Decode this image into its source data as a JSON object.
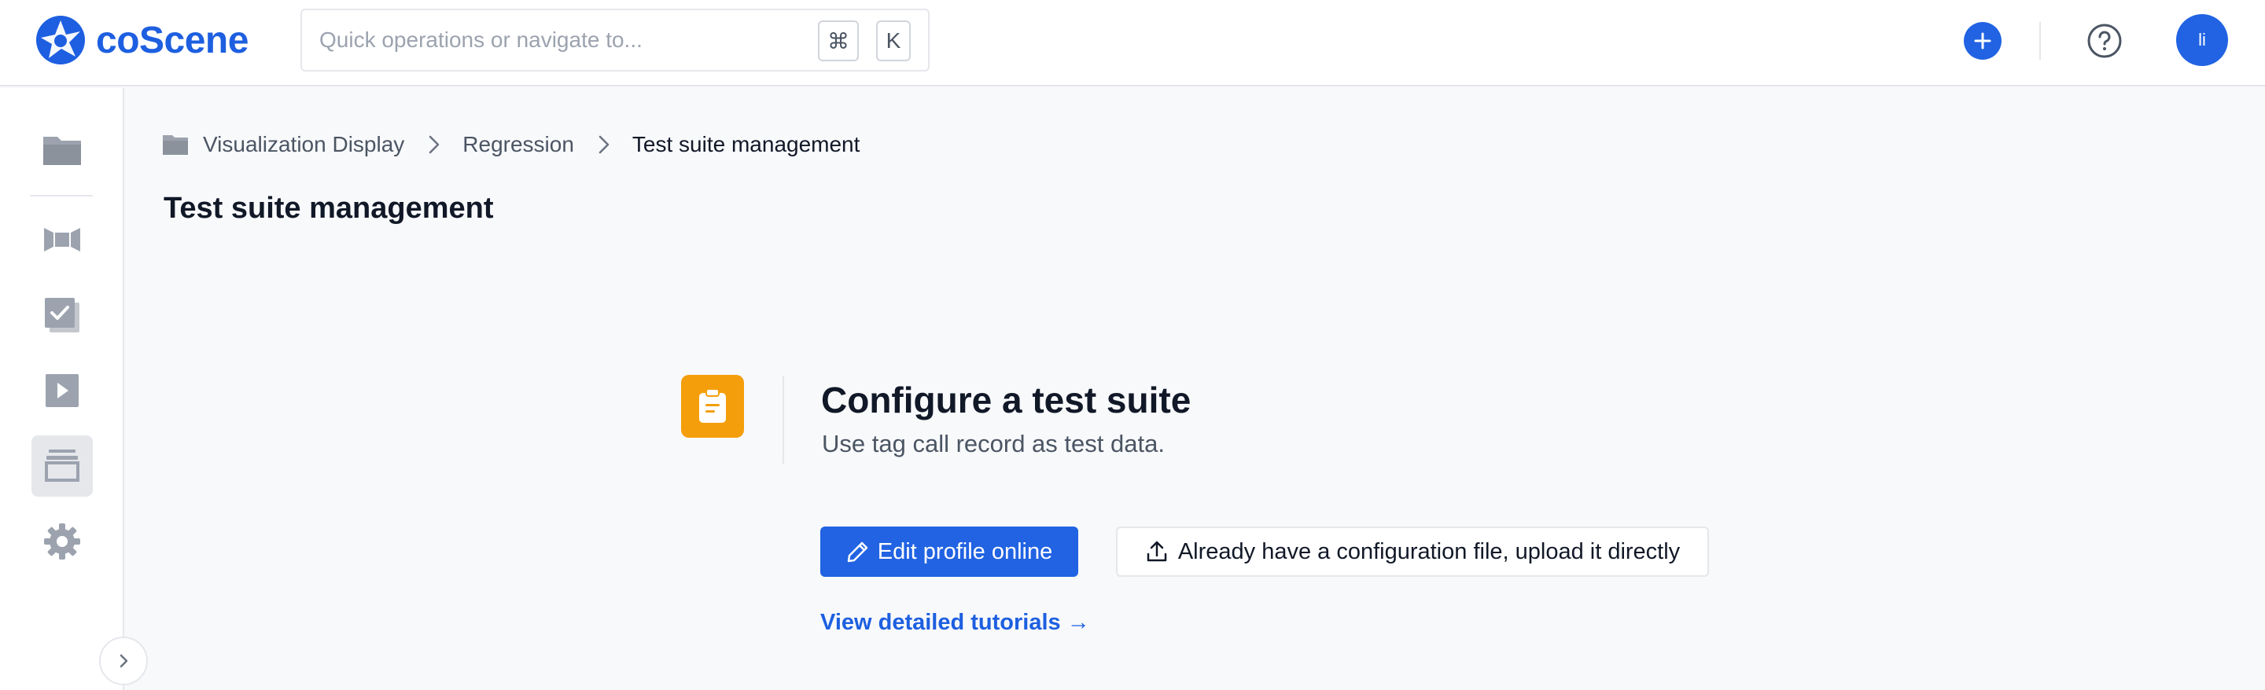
{
  "app": {
    "brand": "coScene"
  },
  "header": {
    "search": {
      "placeholder": "Quick operations or navigate to...",
      "shortcut_mod": "⌘",
      "shortcut_key": "K"
    },
    "avatar_initials": "li",
    "accent_color": "#2163e2"
  },
  "sidebar": {
    "items": [
      {
        "icon": "folder-icon"
      },
      {
        "icon": "bowtie-icon"
      },
      {
        "icon": "checklist-icon"
      },
      {
        "icon": "play-icon"
      },
      {
        "icon": "archive-stack-icon",
        "active": true
      },
      {
        "icon": "gear-icon"
      }
    ]
  },
  "breadcrumb": {
    "items": [
      "Visualization Display",
      "Regression",
      "Test suite management"
    ]
  },
  "page": {
    "title": "Test suite management"
  },
  "empty_state": {
    "icon_color": "#f59e0b",
    "title": "Configure a test suite",
    "description": "Use tag call record as test data.",
    "primary_button": "Edit profile online",
    "secondary_button": "Already have a configuration file, upload it directly",
    "tutorial_link": "View detailed tutorials →"
  }
}
